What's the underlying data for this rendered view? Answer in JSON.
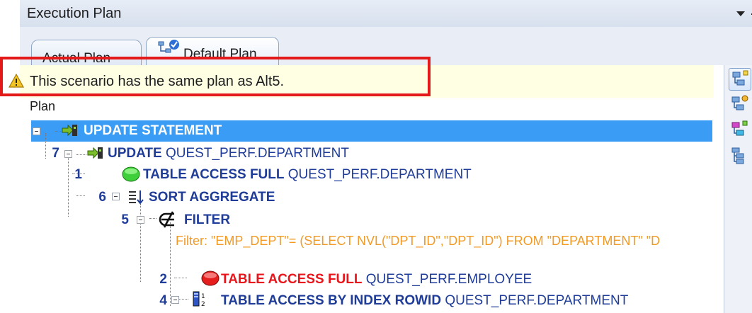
{
  "panel": {
    "title": "Execution Plan"
  },
  "tabs": [
    {
      "label": "Actual Plan"
    },
    {
      "label": "Default Plan"
    }
  ],
  "notice": {
    "text": "This scenario has the same plan as Alt5."
  },
  "plan": {
    "header": "Plan",
    "rows": [
      {
        "num": "",
        "op": "UPDATE STATEMENT",
        "obj": ""
      },
      {
        "num": "7",
        "op": "UPDATE",
        "obj": " QUEST_PERF.DEPARTMENT"
      },
      {
        "num": "1",
        "op": "TABLE ACCESS FULL",
        "obj": " QUEST_PERF.DEPARTMENT"
      },
      {
        "num": "6",
        "op": "SORT AGGREGATE",
        "obj": ""
      },
      {
        "num": "5",
        "op": "FILTER",
        "obj": ""
      },
      {
        "num": "",
        "op": "Filter: \"EMP_DEPT\"= (SELECT NVL(\"DPT_ID\",\"DPT_ID\") FROM \"DEPARTMENT\" \"D",
        "obj": ""
      },
      {
        "num": "2",
        "op": "TABLE ACCESS FULL",
        "obj": " QUEST_PERF.EMPLOYEE"
      },
      {
        "num": "4",
        "op": "TABLE ACCESS BY INDEX ROWID",
        "obj": " QUEST_PERF.DEPARTMENT"
      }
    ]
  },
  "colors": {
    "selection": "#3a9cf5",
    "node_text": "#1f3c98",
    "warning_op": "#e8161c",
    "filter_text": "#f19a26",
    "highlight_outline": "#e41a1a",
    "notice_bg": "#ffffe4"
  },
  "icons": {
    "tab_default": "plan-tree-check-icon",
    "notice": "warning-icon",
    "toolbar": [
      "plan-view-icon",
      "plan-settings-icon",
      "plan-color-icon",
      "plan-tree-icon"
    ]
  }
}
